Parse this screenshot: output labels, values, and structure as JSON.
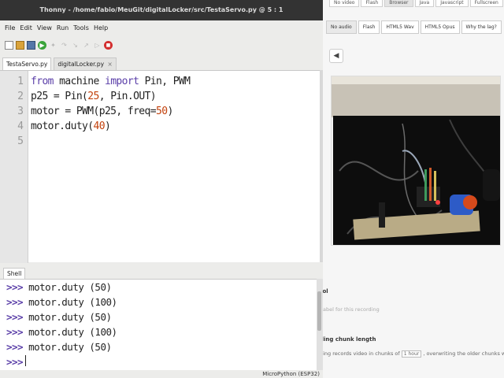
{
  "window": {
    "title": "Thonny  -  /home/fabio/MeuGit/digitalLocker/src/TestaServo.py  @  5 : 1"
  },
  "menu": [
    "File",
    "Edit",
    "View",
    "Run",
    "Tools",
    "Help"
  ],
  "toolbar_icons": [
    "new-file-icon",
    "open-file-icon",
    "save-icon",
    "run-icon",
    "debug-icon",
    "step-over-icon",
    "step-into-icon",
    "step-out-icon",
    "resume-icon",
    "stop-icon"
  ],
  "tabs": [
    {
      "label": "TestaServo.py",
      "active": true
    },
    {
      "label": "digitalLocker.py",
      "active": false,
      "close": "×"
    }
  ],
  "editor": {
    "line_numbers": [
      "1",
      "2",
      "3",
      "4",
      "5"
    ],
    "lines": [
      [
        {
          "t": "from",
          "k": "kw"
        },
        {
          "t": " machine "
        },
        {
          "t": "import",
          "k": "kw"
        },
        {
          "t": " Pin, PWM"
        }
      ],
      [
        {
          "t": "p25 = Pin("
        },
        {
          "t": "25",
          "k": "num"
        },
        {
          "t": ", Pin.OUT)"
        }
      ],
      [
        {
          "t": "motor = PWM(p25, freq="
        },
        {
          "t": "50",
          "k": "num"
        },
        {
          "t": ")"
        }
      ],
      [
        {
          "t": "motor.duty("
        },
        {
          "t": "40",
          "k": "num"
        },
        {
          "t": ")"
        }
      ],
      []
    ]
  },
  "shell": {
    "tab_label": "Shell",
    "prompt": ">>>",
    "history": [
      "motor.duty (50)",
      "motor.duty (100)",
      "motor.duty (50)",
      "motor.duty (100)",
      "motor.duty (50)"
    ],
    "current_input": ""
  },
  "status": {
    "interpreter": "MicroPython (ESP32)"
  },
  "browser": {
    "top_tabs": [
      "No video",
      "Flash",
      "Browser",
      "Java",
      "Javascript",
      "Fullscreen"
    ],
    "top_tab_active": "Browser",
    "audio_tabs": [
      "No audio",
      "Flash",
      "HTML5 Wav",
      "HTML5 Opus",
      "Why the lag?"
    ],
    "audio_tab_active": "No audio",
    "control_heading": "rol",
    "control_text": "abel for this recording",
    "chunk_heading": "ding chunk length",
    "chunk_text_before": "ding records video in chunks of",
    "chunk_value": "1 hour",
    "chunk_text_after": ", overwriting the older chunks when stora"
  }
}
